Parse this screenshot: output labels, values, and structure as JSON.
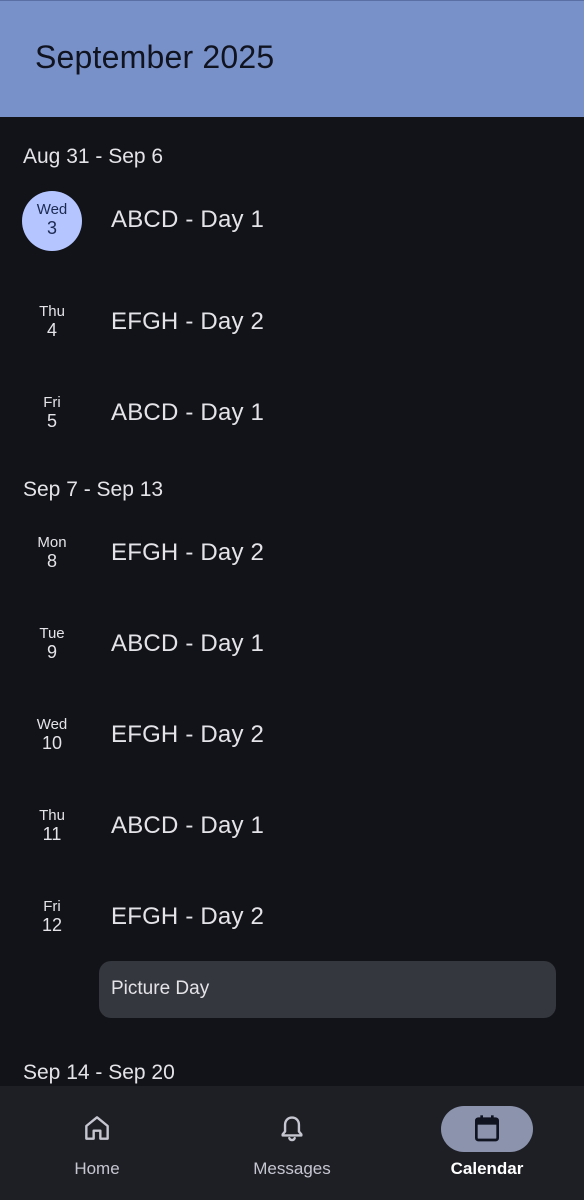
{
  "header": {
    "title": "September 2025"
  },
  "weeks": [
    {
      "label": "Aug 31 - Sep 6",
      "days": [
        {
          "dow": "Wed",
          "dom": "3",
          "event": "ABCD - Day 1",
          "selected": true
        },
        {
          "dow": "Thu",
          "dom": "4",
          "event": "EFGH - Day 2"
        },
        {
          "dow": "Fri",
          "dom": "5",
          "event": "ABCD - Day 1"
        }
      ]
    },
    {
      "label": "Sep 7 - Sep 13",
      "days": [
        {
          "dow": "Mon",
          "dom": "8",
          "event": "EFGH - Day 2"
        },
        {
          "dow": "Tue",
          "dom": "9",
          "event": "ABCD - Day 1"
        },
        {
          "dow": "Wed",
          "dom": "10",
          "event": "EFGH - Day 2"
        },
        {
          "dow": "Thu",
          "dom": "11",
          "event": "ABCD - Day 1"
        },
        {
          "dow": "Fri",
          "dom": "12",
          "event": "EFGH - Day 2",
          "extra_event": "Picture Day"
        }
      ]
    },
    {
      "label": "Sep 14 - Sep 20",
      "days": []
    }
  ],
  "bottom_nav": {
    "items": [
      {
        "label": "Home",
        "icon": "home-icon"
      },
      {
        "label": "Messages",
        "icon": "bell-icon"
      },
      {
        "label": "Calendar",
        "icon": "calendar-icon",
        "active": true
      }
    ]
  },
  "colors": {
    "app_bar": "#7991c9",
    "background": "#121318",
    "selected_date": "#b4c5ff",
    "event_card": "#35373e",
    "nav_bar": "#1e1f25",
    "nav_active_pill": "#8c93ad"
  }
}
